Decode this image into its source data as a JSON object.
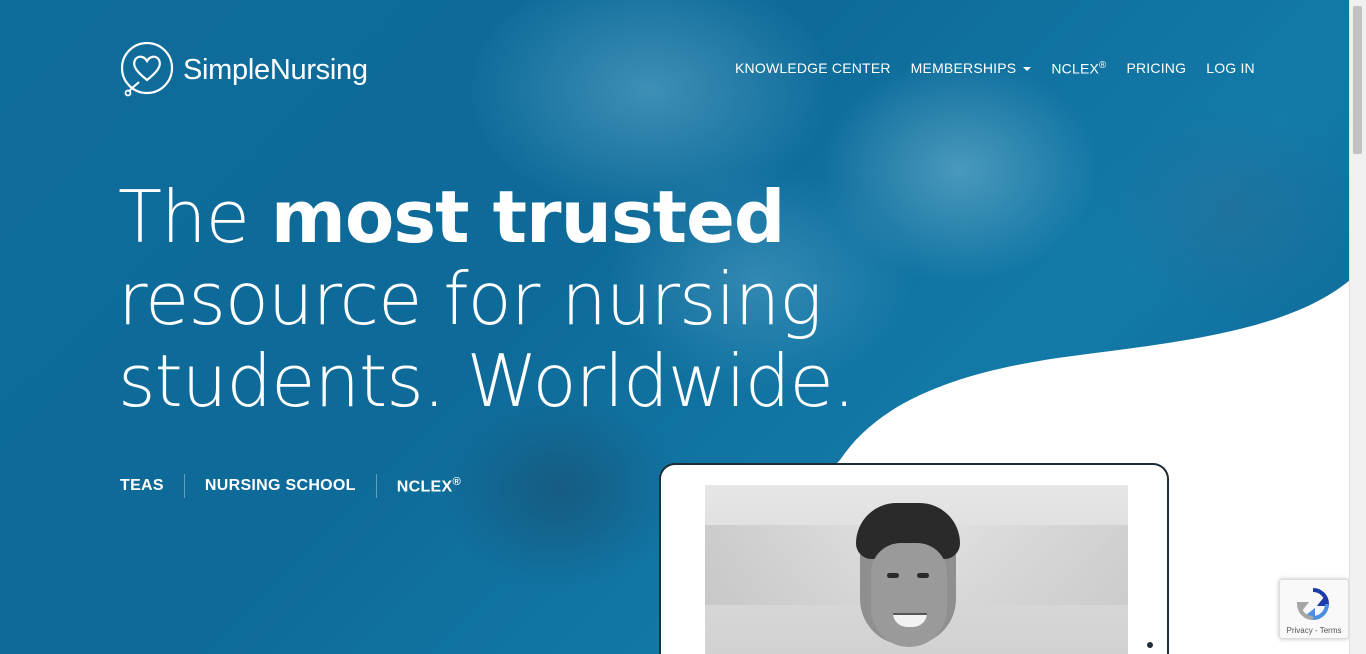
{
  "brand": {
    "name": "SimpleNursing",
    "logo_icon": "heart-stethoscope-icon"
  },
  "nav": {
    "items": [
      {
        "label": "KNOWLEDGE CENTER"
      },
      {
        "label": "MEMBERSHIPS",
        "icon": "caret-down-icon"
      },
      {
        "label": "NCLEX",
        "sup": "®"
      },
      {
        "label": "PRICING"
      },
      {
        "label": "LOG IN"
      }
    ]
  },
  "hero": {
    "line1_prefix": "The",
    "line1_bold": "most trusted",
    "line2": "resource for nursing",
    "line3": "students. Worldwide."
  },
  "pills": {
    "teas": "TEAS",
    "nursing_school": "NURSING SCHOOL",
    "nclex": "NCLEX",
    "nclex_sup": "®"
  },
  "recaptcha": {
    "links": "Privacy - Terms",
    "icon": "recaptcha-icon"
  },
  "colors": {
    "hero_blue": "#0f6d9b",
    "text": "#ffffff",
    "tablet_frame": "#1f2d38"
  }
}
